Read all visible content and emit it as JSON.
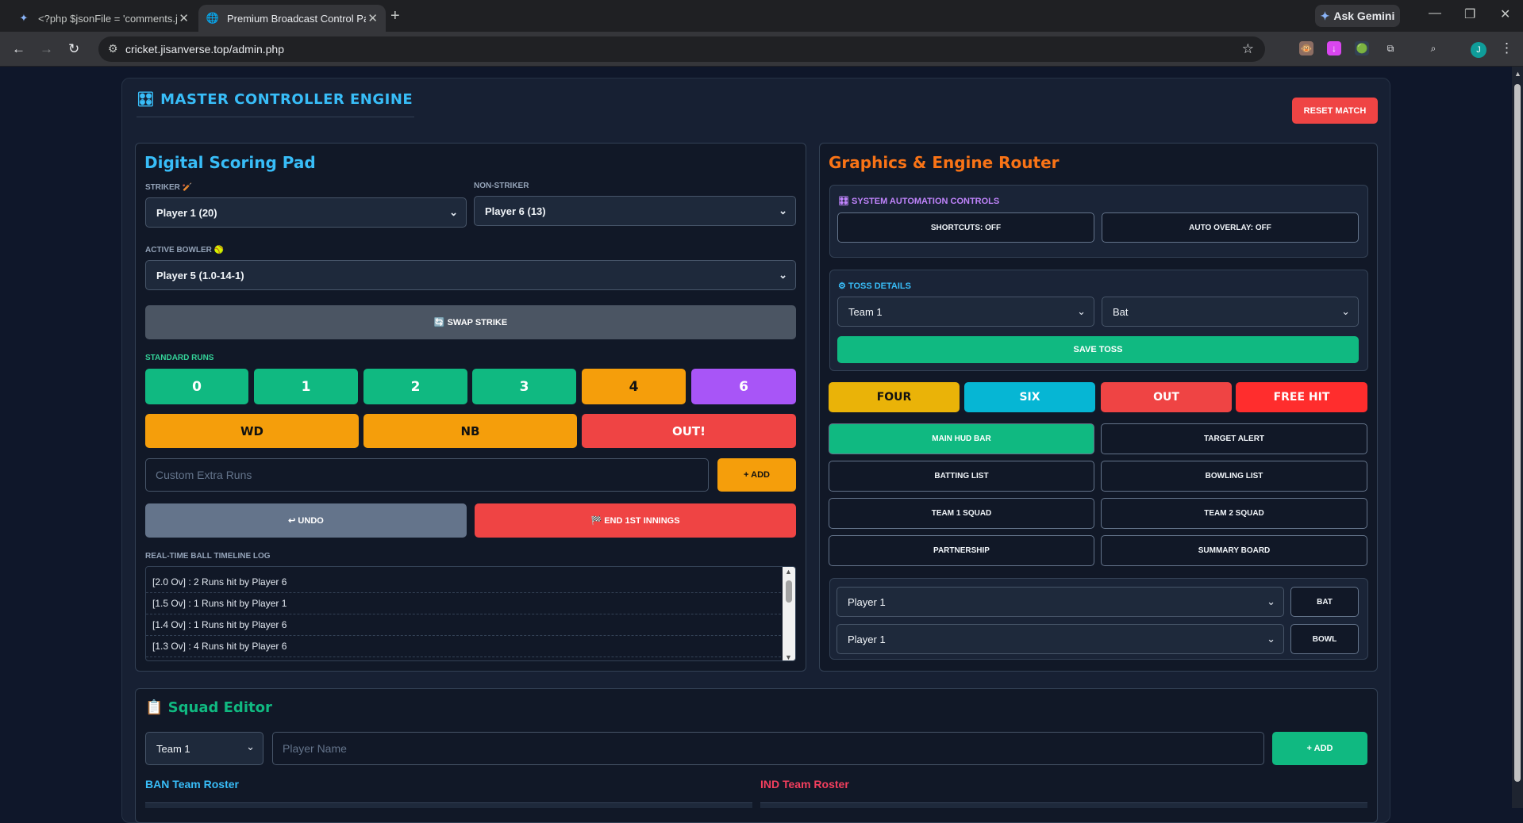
{
  "browser": {
    "tabs": [
      {
        "title": "<?php $jsonFile = 'comments.js"
      },
      {
        "title": "Premium Broadcast Control Pan"
      }
    ],
    "gemini_label": "Ask Gemini",
    "url": "cricket.jisanverse.top/admin.php",
    "avatar_letter": "J"
  },
  "header": {
    "title": "MASTER CONTROLLER ENGINE",
    "reset_label": "RESET MATCH"
  },
  "scoring": {
    "title": "Digital Scoring Pad",
    "striker_label": "STRIKER 🏏",
    "striker_value": "Player 1 (20)",
    "nonstriker_label": "NON-STRIKER",
    "nonstriker_value": "Player 6 (13)",
    "bowler_label": "ACTIVE BOWLER 🥎",
    "bowler_value": "Player 5 (1.0-14-1)",
    "swap_label": "🔄 SWAP STRIKE",
    "runs_label": "STANDARD RUNS",
    "runs": [
      "0",
      "1",
      "2",
      "3",
      "4",
      "6"
    ],
    "extras": [
      "WD",
      "NB",
      "OUT!"
    ],
    "custom_placeholder": "Custom Extra Runs",
    "add_label": "+ ADD",
    "undo_label": "↩ UNDO",
    "end_innings_label": "🏁 END 1ST INNINGS",
    "log_label": "REAL-TIME BALL TIMELINE LOG",
    "log": [
      "[2.0 Ov] : 2 Runs hit by Player 6",
      "[1.5 Ov] : 1 Runs hit by Player 1",
      "[1.4 Ov] : 1 Runs hit by Player 6",
      "[1.3 Ov] : 4 Runs hit by Player 6"
    ]
  },
  "graphics": {
    "title": "Graphics & Engine Router",
    "automation_title": "SYSTEM AUTOMATION CONTROLS",
    "shortcuts_label": "SHORTCUTS: OFF",
    "auto_overlay_label": "AUTO OVERLAY: OFF",
    "toss_title": "TOSS DETAILS",
    "toss_team": "Team 1",
    "toss_choice": "Bat",
    "save_toss_label": "SAVE TOSS",
    "triggers": [
      "FOUR",
      "SIX",
      "OUT",
      "FREE HIT"
    ],
    "overlays": [
      "MAIN HUD BAR",
      "TARGET ALERT",
      "BATTING LIST",
      "BOWLING LIST",
      "TEAM 1 SQUAD",
      "TEAM 2 SQUAD",
      "PARTNERSHIP",
      "SUMMARY BOARD"
    ],
    "player_bat": "Player 1",
    "player_bowl": "Player 1",
    "bat_label": "BAT",
    "bowl_label": "BOWL"
  },
  "squad": {
    "title": "📋 Squad Editor",
    "team_value": "Team 1",
    "name_placeholder": "Player Name",
    "add_label": "+ ADD",
    "roster_left": "BAN Team Roster",
    "roster_right": "IND Team Roster"
  },
  "colors": {
    "accent_blue": "#38bdf8",
    "accent_orange": "#f97316",
    "green": "#10b981",
    "red": "#ef4444",
    "purple": "#a855f7"
  }
}
